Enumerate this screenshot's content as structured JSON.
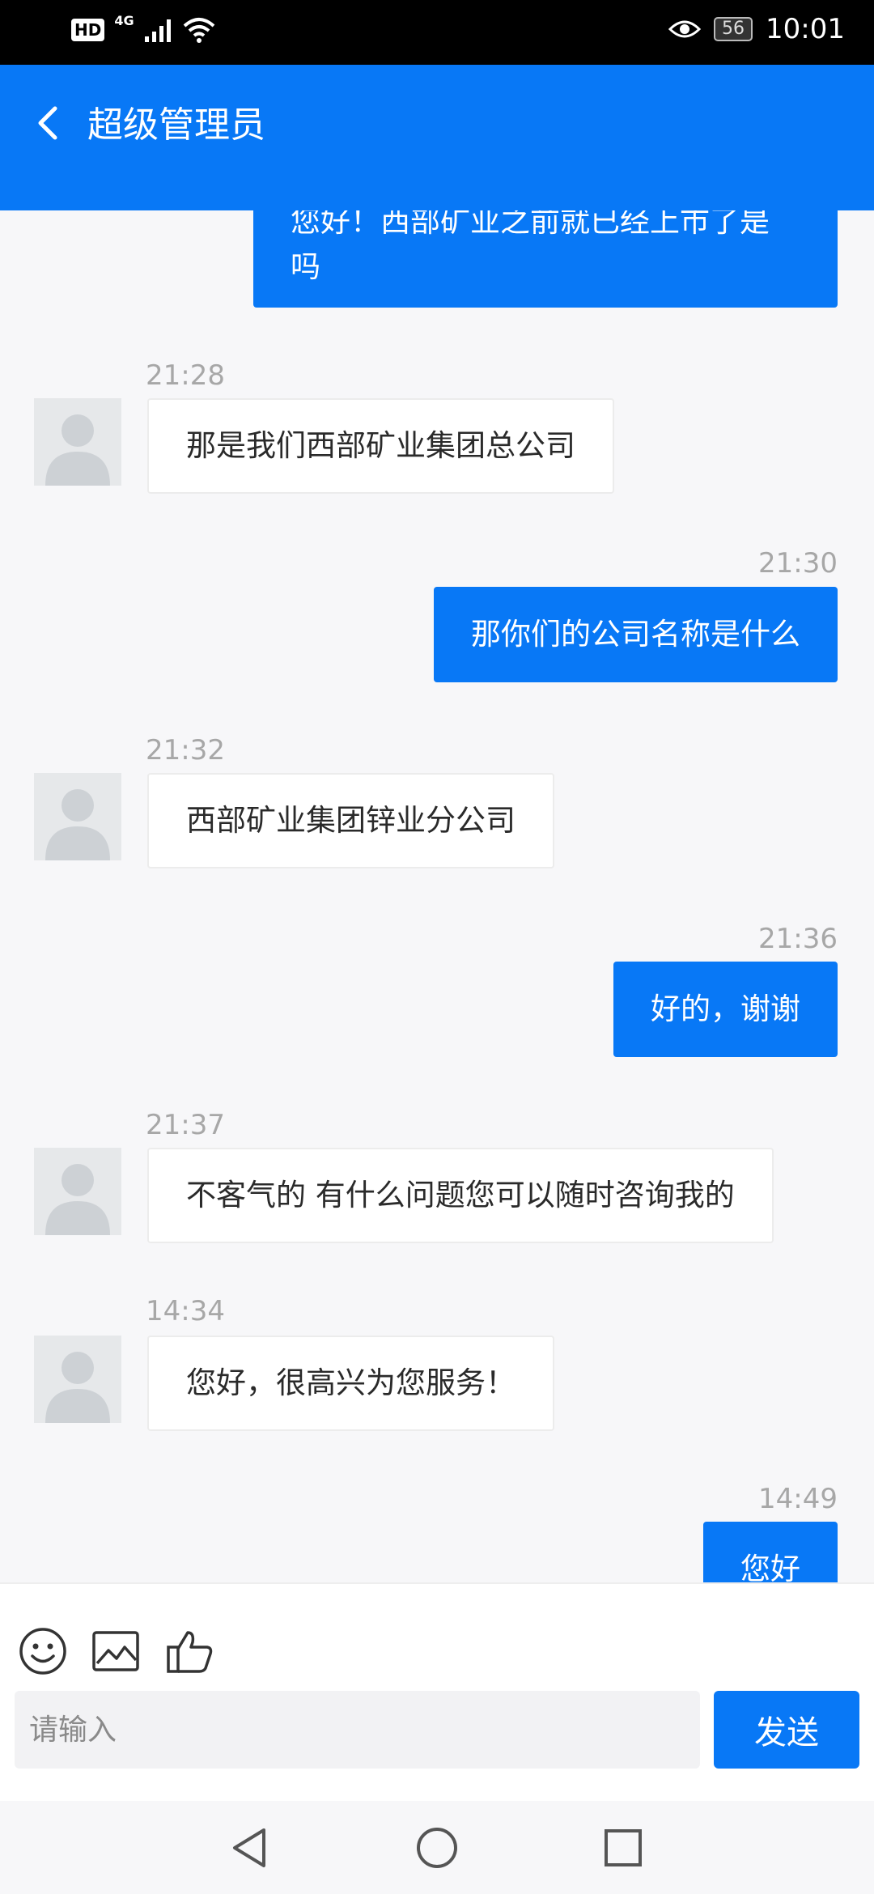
{
  "status_bar": {
    "hd": "HD",
    "network": "4G",
    "battery": "56",
    "time": "10:01"
  },
  "header": {
    "title": "超级管理员"
  },
  "messages": [
    {
      "side": "out",
      "time": "",
      "text_lines": [
        "您好！西部矿业之前就已经上市了是",
        "吗"
      ]
    },
    {
      "side": "in",
      "time": "21:28",
      "text": "那是我们西部矿业集团总公司"
    },
    {
      "side": "out",
      "time": "21:30",
      "text": "那你们的公司名称是什么"
    },
    {
      "side": "in",
      "time": "21:32",
      "text": "西部矿业集团锌业分公司"
    },
    {
      "side": "out",
      "time": "21:36",
      "text": "好的，谢谢"
    },
    {
      "side": "in",
      "time": "21:37",
      "text": "不客气的 有什么问题您可以随时咨询我的"
    },
    {
      "side": "in",
      "time": "14:34",
      "text": "您好，很高兴为您服务！"
    },
    {
      "side": "out",
      "time": "14:49",
      "text": "您好"
    }
  ],
  "composer": {
    "tools": [
      "emoji-icon",
      "image-icon",
      "thumbs-up-icon"
    ],
    "placeholder": "请输入",
    "send_label": "发送"
  },
  "nav": [
    "back",
    "home",
    "recents"
  ],
  "colors": {
    "accent": "#0878f6",
    "background": "#f7f7f9",
    "timestamp": "#a7a7a7"
  }
}
